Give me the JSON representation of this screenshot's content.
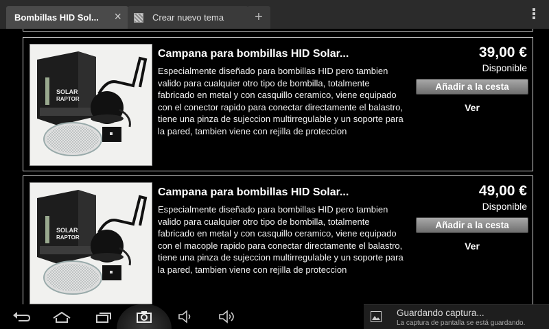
{
  "tabs": [
    {
      "title": "Bombillas HID Sol...",
      "active": true,
      "close_icon": "×"
    },
    {
      "title": "Crear nuevo tema",
      "active": false
    }
  ],
  "new_tab_label": "+",
  "products": [
    {
      "title": "Campana para bombillas HID Solar...",
      "description": "Especialmente diseñado para bombillas HID pero tambien valido para cualquier otro tipo de bombilla, totalmente fabricado en metal y con casquillo ceramico, viene equipado con el conector rapido para conectar directamente el balastro, tiene una pinza de sujeccion multirregulable y un soporte para la pared, tambien viene con rejilla de proteccion",
      "price": "39,00 €",
      "availability": "Disponible",
      "add_to_cart": "Añadir a la cesta",
      "view": "Ver",
      "box_text": "SOLAR RAPTOR"
    },
    {
      "title": "Campana para bombillas HID Solar...",
      "description": "Especialmente diseñado para bombillas HID pero tambien valido para cualquier otro tipo de bombilla, totalmente fabricado en metal y con casquillo ceramico, viene equipado con el macople rapido para conectar directamente el balastro, tiene una pinza de sujeccion multirregulable y un soporte para la pared, tambien viene con rejilla de proteccion",
      "price": "49,00 €",
      "availability": "Disponible",
      "add_to_cart": "Añadir a la cesta",
      "view": "Ver",
      "box_text": "SOLAR RAPTOR"
    }
  ],
  "navbar": {
    "icons": [
      "back-icon",
      "home-icon",
      "recent-apps-icon",
      "screenshot-icon",
      "volume-down-icon",
      "volume-up-icon"
    ]
  },
  "notification": {
    "title": "Guardando captura...",
    "text": "La captura de pantalla se está guardando."
  },
  "colors": {
    "background": "#000000",
    "tabbar": "#2b2b2b",
    "button_gradient_top": "#a8a8a8",
    "button_gradient_bottom": "#6f6f6f"
  }
}
